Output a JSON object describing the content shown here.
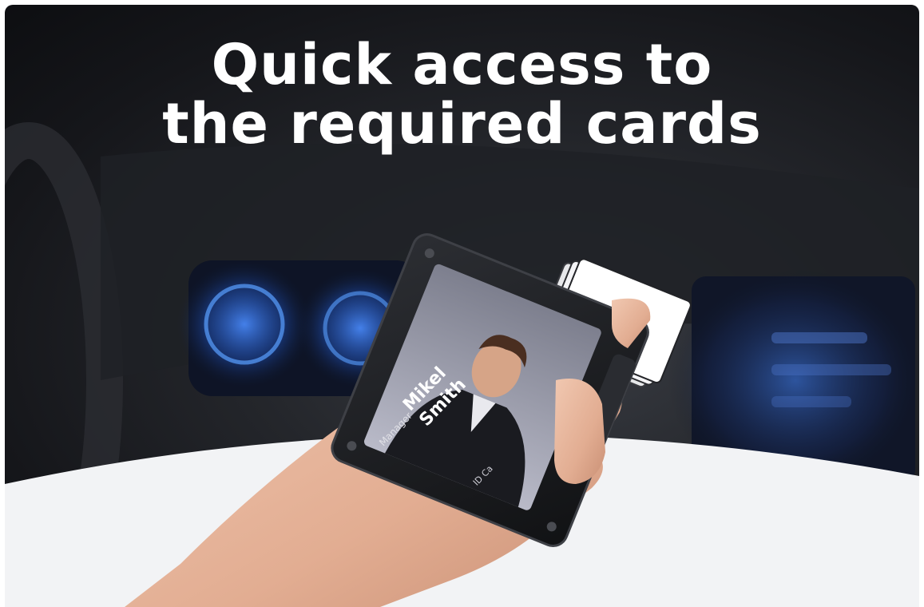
{
  "headline": {
    "line1": "Quick access to",
    "line2": "the required cards"
  },
  "card": {
    "name_line1": "Mikel",
    "name_line2": "Smith",
    "role": "Manager",
    "id_label": "ID Ca"
  },
  "colors": {
    "background_dark": "#15161a",
    "dashboard_blue": "#2f6fe0",
    "wallet_black": "#1b1c1f",
    "skin": "#e7b9a0",
    "bottom_curve": "#f2f3f5",
    "text_white": "#ffffff"
  }
}
